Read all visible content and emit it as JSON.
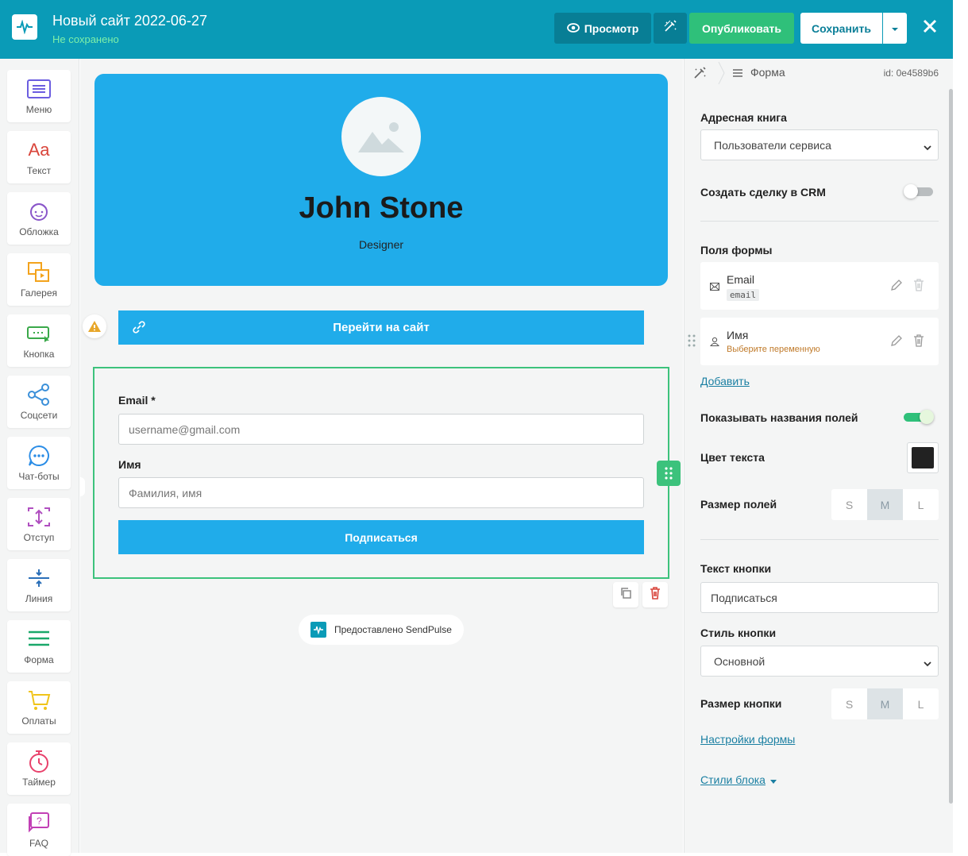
{
  "header": {
    "title": "Новый сайт 2022-06-27",
    "status": "Не сохранено",
    "preview_label": "Просмотр",
    "publish_label": "Опубликовать",
    "save_label": "Сохранить"
  },
  "sidebar": {
    "items": [
      {
        "label": "Меню",
        "icon": "menu-icon"
      },
      {
        "label": "Текст",
        "icon": "text-icon"
      },
      {
        "label": "Обложка",
        "icon": "cover-icon"
      },
      {
        "label": "Галерея",
        "icon": "gallery-icon"
      },
      {
        "label": "Кнопка",
        "icon": "button-icon"
      },
      {
        "label": "Соцсети",
        "icon": "share-icon"
      },
      {
        "label": "Чат-боты",
        "icon": "chat-icon"
      },
      {
        "label": "Отступ",
        "icon": "spacing-icon"
      },
      {
        "label": "Линия",
        "icon": "line-icon"
      },
      {
        "label": "Форма",
        "icon": "form-icon"
      },
      {
        "label": "Оплаты",
        "icon": "cart-icon"
      },
      {
        "label": "Таймер",
        "icon": "timer-icon"
      },
      {
        "label": "FAQ",
        "icon": "faq-icon"
      }
    ]
  },
  "canvas": {
    "hero": {
      "name": "John Stone",
      "role": "Designer"
    },
    "link_button": "Перейти на сайт",
    "form": {
      "email_label": "Email *",
      "email_placeholder": "username@gmail.com",
      "name_label": "Имя",
      "name_placeholder": "Фамилия, имя",
      "submit_label": "Подписаться"
    },
    "powered_by": "Предоставлено SendPulse"
  },
  "panel": {
    "breadcrumb": {
      "item": "Форма",
      "id": "id: 0e4589b6"
    },
    "address_book_label": "Адресная книга",
    "address_book_value": "Пользователи сервиса",
    "crm_label": "Создать сделку в CRM",
    "crm_enabled": false,
    "fields_label": "Поля формы",
    "fields": [
      {
        "name": "Email",
        "sub": "email",
        "icon": "mail-icon"
      },
      {
        "name": "Имя",
        "sub": "Выберите переменную",
        "icon": "user-icon"
      }
    ],
    "add_link": "Добавить",
    "show_names_label": "Показывать названия полей",
    "show_names_enabled": true,
    "text_color_label": "Цвет текста",
    "text_color": "#222222",
    "field_size_label": "Размер полей",
    "sizes": [
      "S",
      "M",
      "L"
    ],
    "field_size_selected": "M",
    "button_text_label": "Текст кнопки",
    "button_text_value": "Подписаться",
    "button_style_label": "Стиль кнопки",
    "button_style_value": "Основной",
    "button_size_label": "Размер кнопки",
    "button_size_selected": "M",
    "form_settings_link": "Настройки формы",
    "block_styles_link": "Стили блока"
  },
  "colors": {
    "header_bg": "#0a9bb7",
    "accent": "#20acea",
    "publish": "#2fc07a",
    "selection": "#3cc27c"
  }
}
